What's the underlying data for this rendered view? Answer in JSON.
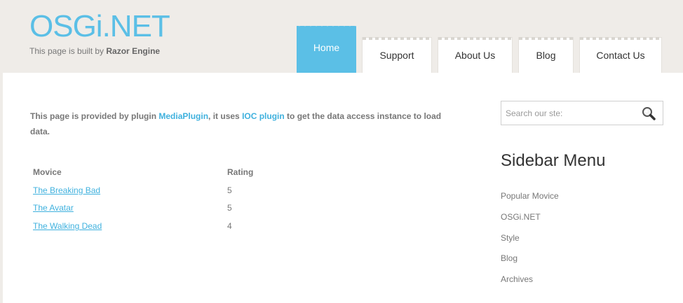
{
  "brand": {
    "logo": "OSGi.NET",
    "tagline_prefix": "This page is built by ",
    "tagline_strong": "Razor Engine"
  },
  "nav": {
    "tabs": [
      {
        "label": "Home",
        "active": true
      },
      {
        "label": "Support",
        "active": false
      },
      {
        "label": "About Us",
        "active": false
      },
      {
        "label": "Blog",
        "active": false
      },
      {
        "label": "Contact Us",
        "active": false
      }
    ]
  },
  "main": {
    "intro": {
      "p1": "This page is provided by plugin ",
      "link1": "MediaPlugin",
      "p2": ", it uses ",
      "link2": "IOC plugin",
      "p3": " to get the data access instance to load data."
    },
    "table": {
      "headers": [
        "Movice",
        "Rating"
      ],
      "rows": [
        {
          "title": "The Breaking Bad",
          "rating": "5"
        },
        {
          "title": "The Avatar",
          "rating": "5"
        },
        {
          "title": "The Walking Dead",
          "rating": "4"
        }
      ]
    }
  },
  "search": {
    "placeholder": "Search our ste:",
    "icon": "magnifier-icon"
  },
  "sidebar": {
    "title": "Sidebar Menu",
    "items": [
      {
        "label": "Popular Movice"
      },
      {
        "label": "OSGi.NET"
      },
      {
        "label": "Style"
      },
      {
        "label": "Blog"
      },
      {
        "label": "Archives"
      }
    ]
  },
  "colors": {
    "accent": "#5bbfe6",
    "link": "#3fb1de",
    "page_bg": "#efece8",
    "text": "#777777"
  }
}
